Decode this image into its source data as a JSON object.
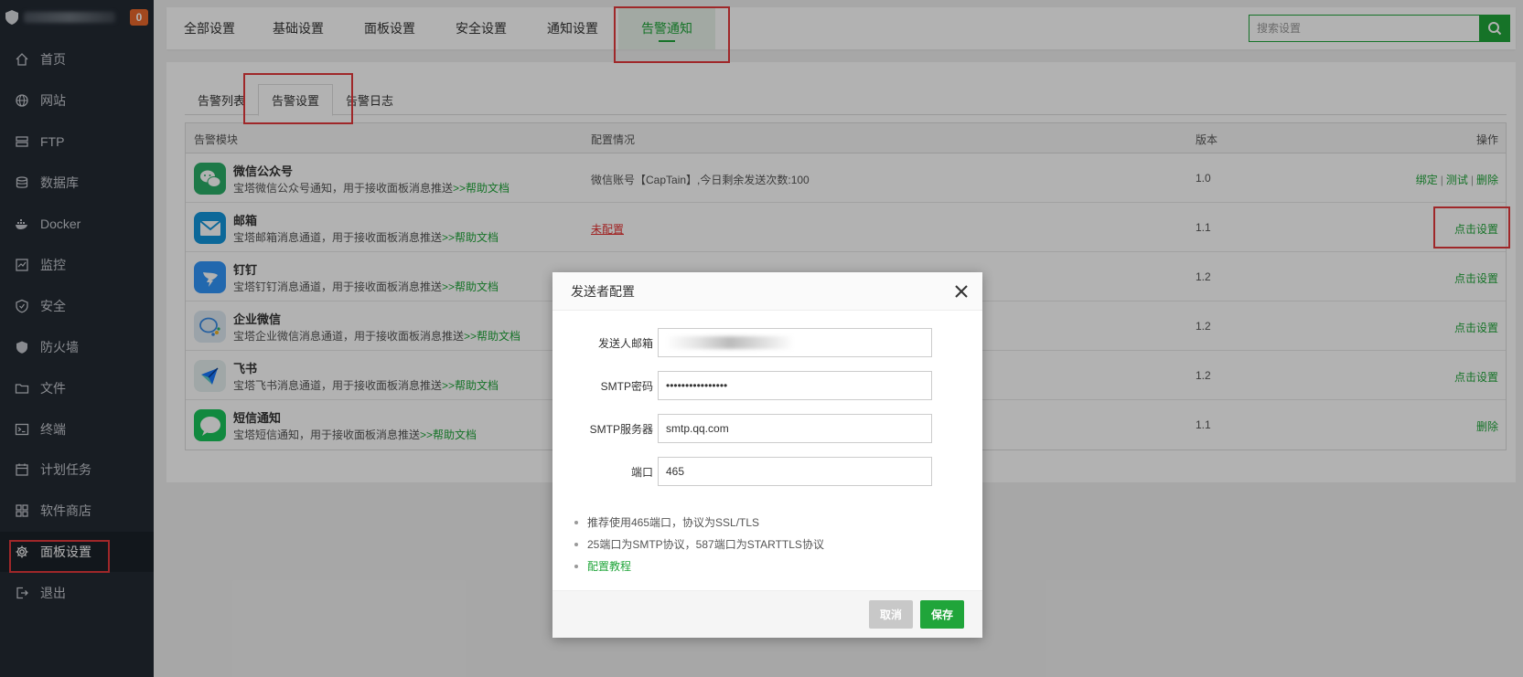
{
  "sidebar": {
    "badge": "0",
    "items": [
      {
        "label": "首页",
        "icon": "home-icon"
      },
      {
        "label": "网站",
        "icon": "globe-icon"
      },
      {
        "label": "FTP",
        "icon": "ftp-icon"
      },
      {
        "label": "数据库",
        "icon": "database-icon"
      },
      {
        "label": "Docker",
        "icon": "docker-icon"
      },
      {
        "label": "监控",
        "icon": "monitor-icon"
      },
      {
        "label": "安全",
        "icon": "shield-icon"
      },
      {
        "label": "防火墙",
        "icon": "firewall-icon"
      },
      {
        "label": "文件",
        "icon": "folder-icon"
      },
      {
        "label": "终端",
        "icon": "terminal-icon"
      },
      {
        "label": "计划任务",
        "icon": "calendar-icon"
      },
      {
        "label": "软件商店",
        "icon": "apps-icon"
      },
      {
        "label": "面板设置",
        "icon": "gear-icon"
      },
      {
        "label": "退出",
        "icon": "logout-icon"
      }
    ],
    "active_index": 12
  },
  "top_tabs": [
    "全部设置",
    "基础设置",
    "面板设置",
    "安全设置",
    "通知设置",
    "告警通知"
  ],
  "top_active": 5,
  "search": {
    "placeholder": "搜索设置"
  },
  "sub_tabs": [
    "告警列表",
    "告警设置",
    "告警日志"
  ],
  "sub_active": 1,
  "table": {
    "headers": {
      "module": "告警模块",
      "config": "配置情况",
      "version": "版本",
      "ops": "操作"
    },
    "rows": [
      {
        "name": "微信公众号",
        "desc": "宝塔微信公众号通知，用于接收面板消息推送",
        "link": ">>帮助文档",
        "config": "微信账号【CapTain】,今日剩余发送次数:100",
        "version": "1.0",
        "ops": [
          "绑定",
          "测试",
          "删除"
        ],
        "icon": "wechat-icon",
        "color": "#2aae67"
      },
      {
        "name": "邮箱",
        "desc": "宝塔邮箱消息通道，用于接收面板消息推送",
        "link": ">>帮助文档",
        "config": "未配置",
        "version": "1.1",
        "ops": [
          "点击设置"
        ],
        "icon": "mail-icon",
        "color": "#1296db"
      },
      {
        "name": "钉钉",
        "desc": "宝塔钉钉消息通道，用于接收面板消息推送",
        "link": ">>帮助文档",
        "config": "",
        "version": "1.2",
        "ops": [
          "点击设置"
        ],
        "icon": "dingtalk-icon",
        "color": "#3296fa"
      },
      {
        "name": "企业微信",
        "desc": "宝塔企业微信消息通道，用于接收面板消息推送",
        "link": ">>帮助文档",
        "config": "",
        "version": "1.2",
        "ops": [
          "点击设置"
        ],
        "icon": "wecom-icon",
        "color": "#dfeaf3"
      },
      {
        "name": "飞书",
        "desc": "宝塔飞书消息通道，用于接收面板消息推送",
        "link": ">>帮助文档",
        "config": "",
        "version": "1.2",
        "ops": [
          "点击设置"
        ],
        "icon": "feishu-icon",
        "color": "#e6f0f0"
      },
      {
        "name": "短信通知",
        "desc": "宝塔短信通知，用于接收面板消息推送",
        "link": ">>帮助文档",
        "config": "",
        "version": "1.1",
        "ops": [
          "删除"
        ],
        "icon": "sms-icon",
        "color": "#19c45b"
      }
    ]
  },
  "modal": {
    "title": "发送者配置",
    "fields": [
      {
        "label": "发送人邮箱",
        "value": ""
      },
      {
        "label": "SMTP密码",
        "value": "••••••••••••••••"
      },
      {
        "label": "SMTP服务器",
        "value": "smtp.qq.com"
      },
      {
        "label": "端口",
        "value": "465"
      }
    ],
    "tips": [
      "推荐使用465端口，协议为SSL/TLS",
      "25端口为SMTP协议，587端口为STARTTLS协议",
      "配置教程"
    ],
    "cancel": "取消",
    "save": "保存"
  },
  "colors": {
    "accent": "#20a53a",
    "sidebar": "#232a33",
    "highlight": "#e4393c"
  }
}
